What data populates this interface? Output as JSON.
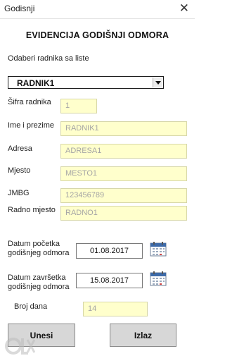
{
  "window": {
    "title": "Godisnji"
  },
  "form": {
    "heading": "EVIDENCIJA GODIŠNJI ODMORA",
    "select_prompt": "Odaberi radnika sa liste",
    "employee_select": {
      "selected": "RADNIK1"
    },
    "fields": {
      "sifra": {
        "label": "Šifra radnika",
        "value": "1"
      },
      "ime": {
        "label": "Ime i prezime",
        "value": "RADNIK1"
      },
      "adresa": {
        "label": "Adresa",
        "value": "ADRESA1"
      },
      "mjesto": {
        "label": "Mjesto",
        "value": "MESTO1"
      },
      "jmbg": {
        "label": "JMBG",
        "value": "123456789"
      },
      "radno_mjesto": {
        "label": "Radno mjesto",
        "value": "RADNO1"
      }
    },
    "start_date": {
      "label_line1": "Datum početka",
      "label_line2": "godišnjeg odmora",
      "value": "01.08.2017"
    },
    "end_date": {
      "label_line1": "Datum završetka",
      "label_line2": "godišnjeg odmora",
      "value": "15.08.2017"
    },
    "days": {
      "label": "Broj dana",
      "value": "14"
    }
  },
  "buttons": {
    "submit": "Unesi",
    "exit": "Izlaz"
  },
  "icons": {
    "close": "close-icon",
    "calendar": "calendar-icon",
    "dropdown": "chevron-down-icon"
  },
  "colors": {
    "readonly_bg": "#ffffcc",
    "button_bg": "#d7d7d7"
  }
}
